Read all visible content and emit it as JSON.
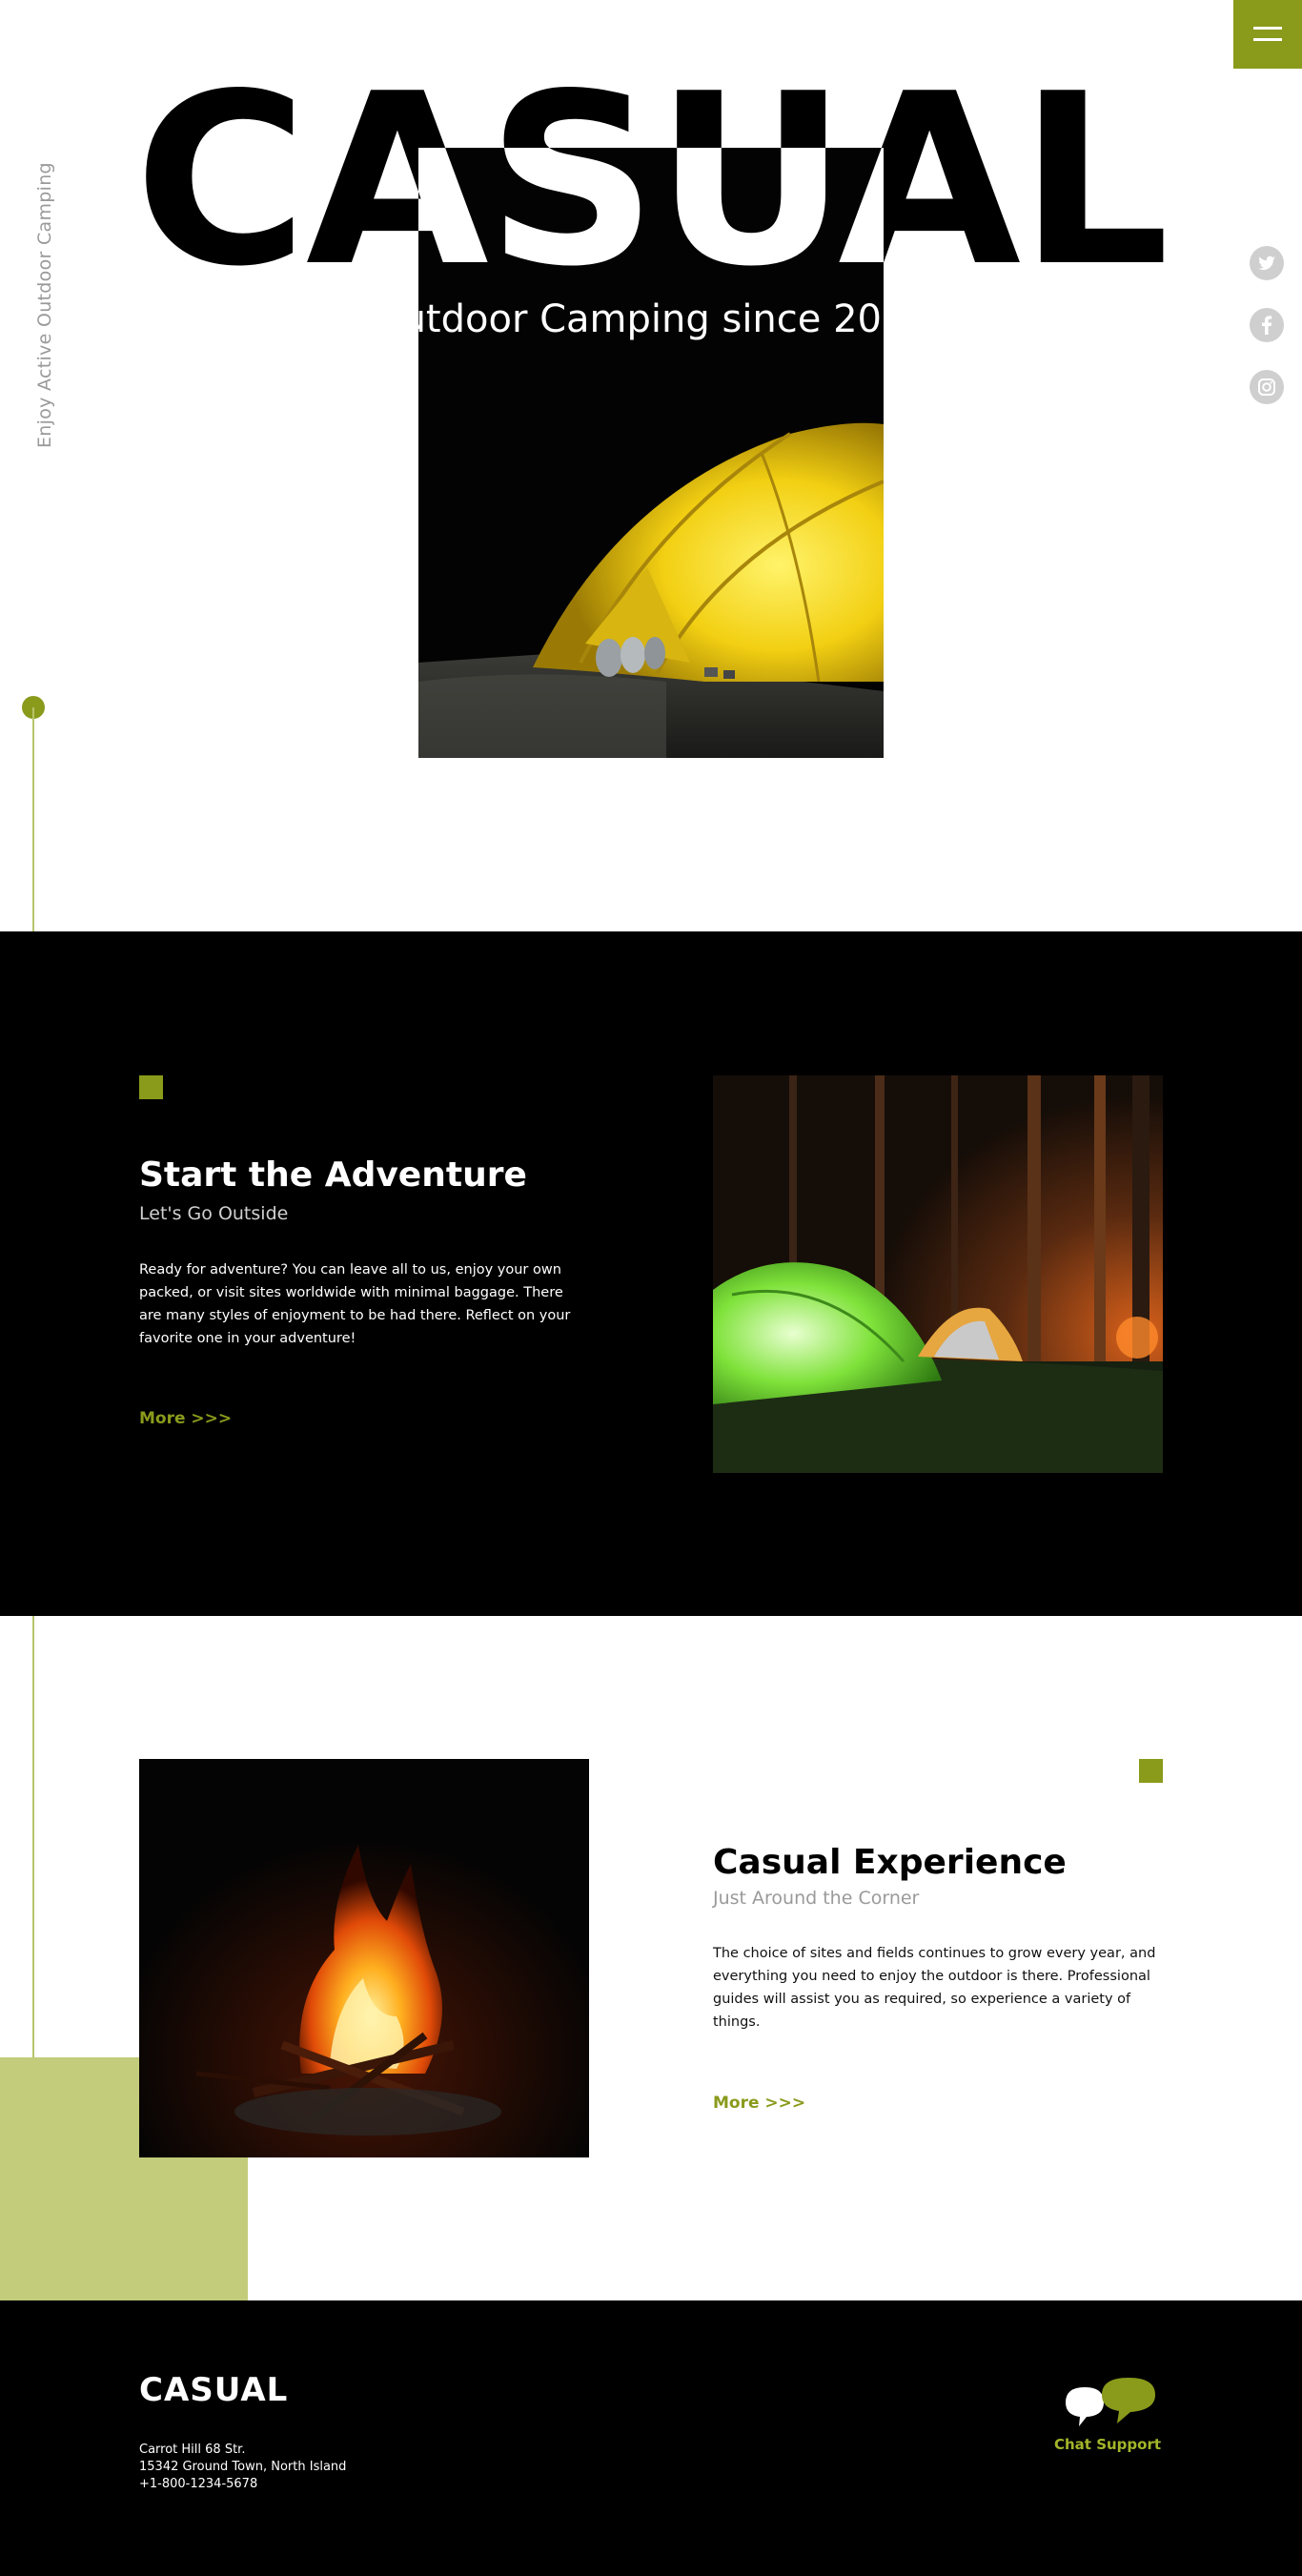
{
  "hero": {
    "brand": "CASUAL",
    "tagline": "Outdoor Camping since 2001",
    "side_caption": "Enjoy Active Outdoor Camping"
  },
  "menu": {
    "icon": "hamburger-menu-icon"
  },
  "social": [
    {
      "name": "twitter",
      "icon": "twitter-icon"
    },
    {
      "name": "facebook",
      "icon": "facebook-icon"
    },
    {
      "name": "instagram",
      "icon": "instagram-icon"
    }
  ],
  "sections": {
    "adventure": {
      "title": "Start the Adventure",
      "subtitle": "Let's Go Outside",
      "body": "Ready for adventure? You can leave all to us, enjoy your own packed, or visit sites worldwide with minimal baggage. There are many styles of enjoyment to be had there. Reflect on your favorite one in your adventure!",
      "more": "More >>>"
    },
    "experience": {
      "title": "Casual Experience",
      "subtitle": "Just Around the Corner",
      "body": "The choice of sites and fields continues to grow every year, and everything you need to enjoy the outdoor is there. Professional guides will assist you as required, so experience a variety of things.",
      "more": "More >>>"
    }
  },
  "footer": {
    "logo": "CASUAL",
    "address_line1": "Carrot Hill 68 Str.",
    "address_line2": "15342  Ground Town, North Island",
    "phone": "+1-800-1234-5678",
    "chat_label": "Chat Support"
  },
  "colors": {
    "accent": "#8a9a1b",
    "accent_light": "#c3cc7a",
    "dark": "#000000",
    "muted": "#9a9a9a"
  }
}
